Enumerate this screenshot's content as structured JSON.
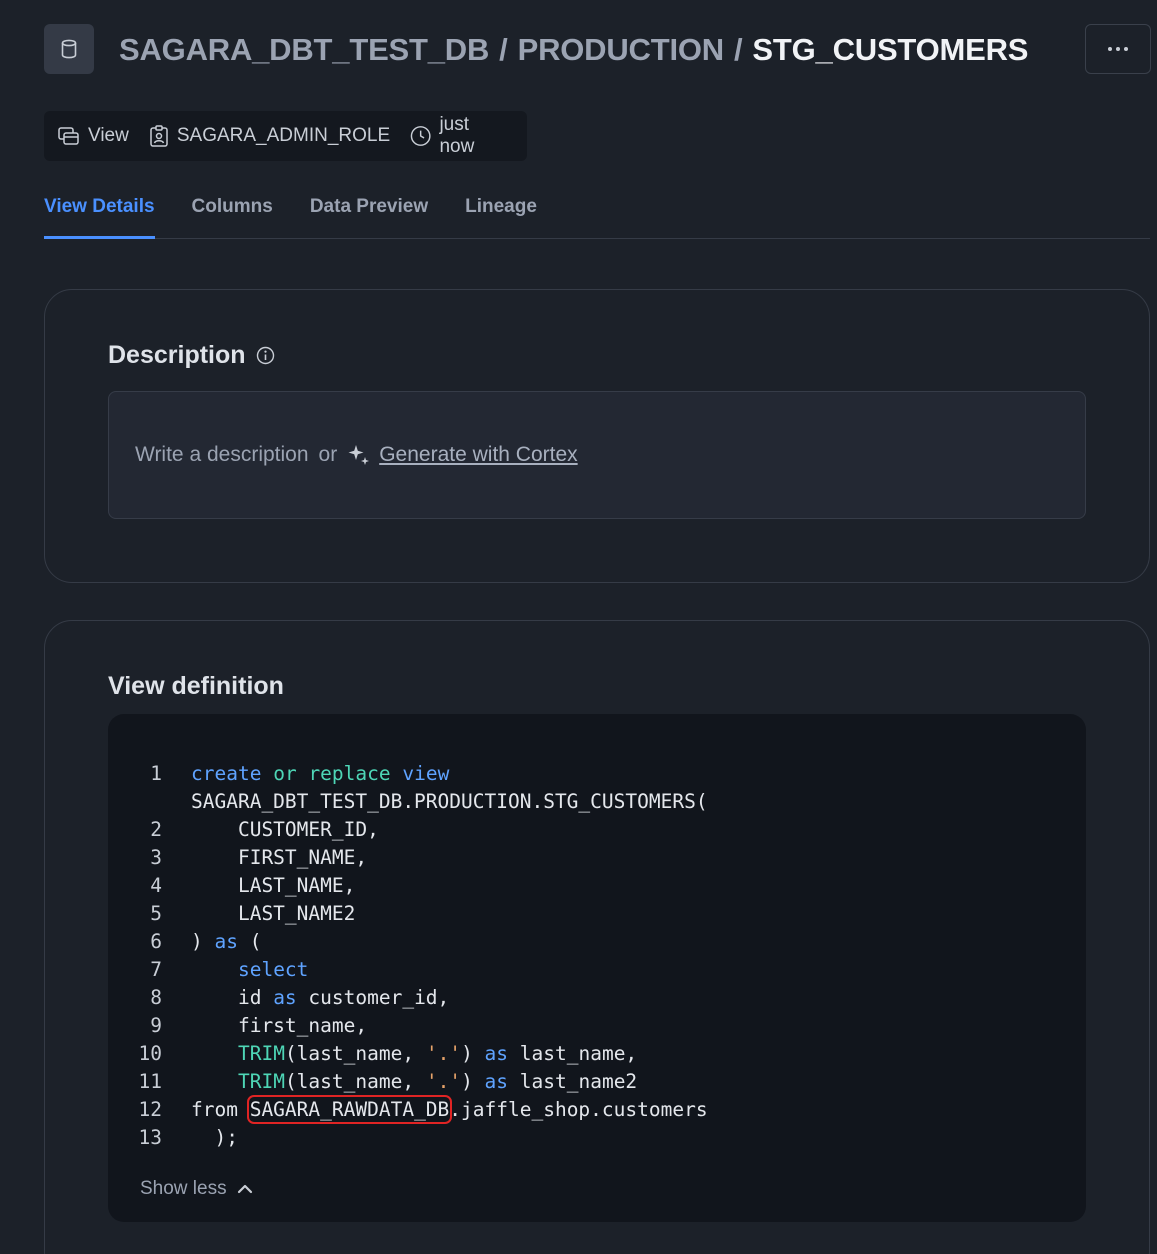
{
  "breadcrumb": {
    "database": "SAGARA_DBT_TEST_DB",
    "schema": "PRODUCTION",
    "object": "STG_CUSTOMERS",
    "separator": "/"
  },
  "meta": {
    "type": "View",
    "role": "SAGARA_ADMIN_ROLE",
    "updated": "just now"
  },
  "tabs": [
    "View Details",
    "Columns",
    "Data Preview",
    "Lineage"
  ],
  "active_tab": "View Details",
  "description": {
    "title": "Description",
    "placeholder": "Write a description",
    "or": "or",
    "cortex_link": "Generate with Cortex"
  },
  "view_definition": {
    "title": "View definition",
    "show_less": "Show less",
    "highlighted_token": "SAGARA_RAWDATA_DB",
    "lines": [
      {
        "n": "1",
        "text": "create or replace view"
      },
      {
        "n": "",
        "text": "SAGARA_DBT_TEST_DB.PRODUCTION.STG_CUSTOMERS("
      },
      {
        "n": "2",
        "text": "    CUSTOMER_ID,"
      },
      {
        "n": "3",
        "text": "    FIRST_NAME,"
      },
      {
        "n": "4",
        "text": "    LAST_NAME,"
      },
      {
        "n": "5",
        "text": "    LAST_NAME2"
      },
      {
        "n": "6",
        "text": ") as ("
      },
      {
        "n": "7",
        "text": "    select"
      },
      {
        "n": "8",
        "text": "    id as customer_id,"
      },
      {
        "n": "9",
        "text": "    first_name,"
      },
      {
        "n": "10",
        "text": "    TRIM(last_name, '.') as last_name,"
      },
      {
        "n": "11",
        "text": "    TRIM(last_name, '.') as last_name2"
      },
      {
        "n": "12",
        "text": "from SAGARA_RAWDATA_DB.jaffle_shop.customers"
      },
      {
        "n": "13",
        "text": "  );"
      }
    ]
  },
  "colors": {
    "accent": "#4a90ff",
    "keyword": "#5fa3ff",
    "function": "#4ed6b6",
    "string": "#e7a36a",
    "highlight_border": "#e02424"
  }
}
